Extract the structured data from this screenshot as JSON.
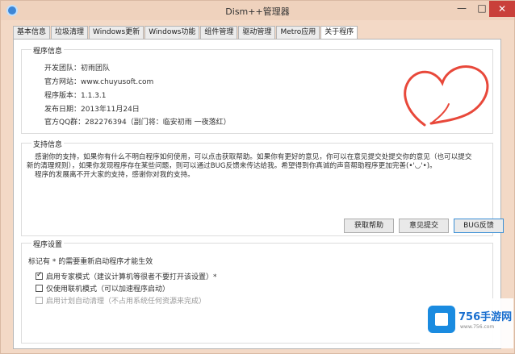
{
  "window": {
    "title": "Dism++管理器",
    "controls": {
      "minimize": "—",
      "maximize": "□",
      "close": "✕"
    }
  },
  "tabs": [
    {
      "label": "基本信息",
      "active": false
    },
    {
      "label": "垃圾清理",
      "active": false
    },
    {
      "label": "Windows更新",
      "active": false
    },
    {
      "label": "Windows功能",
      "active": false
    },
    {
      "label": "组件管理",
      "active": false
    },
    {
      "label": "驱动管理",
      "active": false
    },
    {
      "label": "Metro应用",
      "active": false
    },
    {
      "label": "关于程序",
      "active": true
    }
  ],
  "program_info": {
    "title": "程序信息",
    "team": "开发团队：初雨团队",
    "website": "官方网站：www.chuyusoft.com",
    "version": "程序版本：1.1.3.1",
    "release_date": "发布日期：2013年11月24日",
    "qq_group": "官方QQ群：282276394（副门将：临安初雨 一夜落红）"
  },
  "support": {
    "title": "支持信息",
    "line1": "感谢你的支持，如果你有什么不明白程序如何使用，可以点击获取帮助。如果你有更好的意见，你可以在意见提交处提交你的意见（也可以提交",
    "line2": "新的清理规则），如果你发现程序存在某些问题，则可以通过BUG反馈来传达给我。希望得到你真诚的声音帮助程序更加完善(•'◡'•)。",
    "line3": "程序的发展离不开大家的支持，感谢你对我的支持。",
    "buttons": {
      "help": "获取帮助",
      "feedback": "意见提交",
      "bug": "BUG反馈"
    }
  },
  "settings": {
    "title": "程序设置",
    "note": "标记有 * 的需要重新启动程序才能生效",
    "options": [
      {
        "label": "启用专家模式（建议计算机等很者不要打开该设置）*",
        "checked": true,
        "enabled": true
      },
      {
        "label": "仅使用联机模式（可以加速程序启动）",
        "checked": false,
        "enabled": true
      },
      {
        "label": "启用计划自动清理（不占用系统任何资源来完成）",
        "checked": false,
        "enabled": false
      }
    ]
  },
  "watermark": {
    "name": "756手游网",
    "url": "www.756.com"
  },
  "colors": {
    "accent": "#3b8fd6",
    "heart": "#e8483a",
    "close": "#c9403a"
  }
}
